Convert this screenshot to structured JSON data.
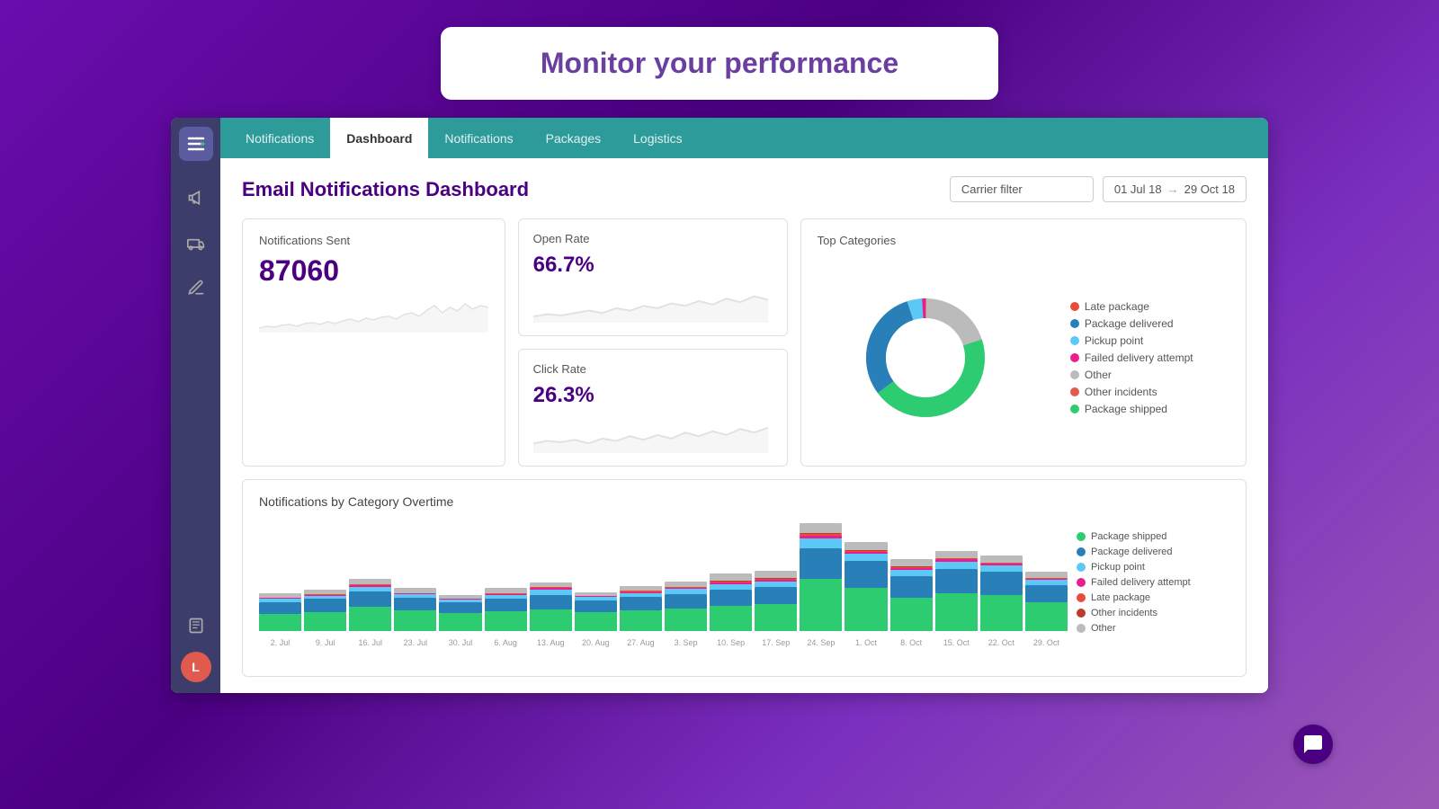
{
  "banner": {
    "title": "Monitor your performance"
  },
  "navbar": {
    "items": [
      {
        "label": "Notifications",
        "active": false
      },
      {
        "label": "Dashboard",
        "active": true
      },
      {
        "label": "Notifications",
        "active": false
      },
      {
        "label": "Packages",
        "active": false
      },
      {
        "label": "Logistics",
        "active": false
      }
    ]
  },
  "page": {
    "title": "Email Notifications Dashboard",
    "carrier_filter_placeholder": "Carrier filter",
    "date_from": "01 Jul 18",
    "date_to": "29 Oct 18"
  },
  "stats": {
    "notifications_sent": {
      "label": "Notifications Sent",
      "value": "87060"
    },
    "open_rate": {
      "label": "Open Rate",
      "value": "66.7%"
    },
    "click_rate": {
      "label": "Click Rate",
      "value": "26.3%"
    }
  },
  "top_categories": {
    "title": "Top Categories",
    "legend": [
      {
        "label": "Late package",
        "color": "#e74c3c"
      },
      {
        "label": "Package delivered",
        "color": "#2980b9"
      },
      {
        "label": "Pickup point",
        "color": "#5bc8f5"
      },
      {
        "label": "Failed delivery attempt",
        "color": "#e91e8c"
      },
      {
        "label": "Other",
        "color": "#bbb"
      },
      {
        "label": "Other incidents",
        "color": "#e05a4e"
      },
      {
        "label": "Package shipped",
        "color": "#2ecc71"
      }
    ]
  },
  "bottom_chart": {
    "title": "Notifications by Category Overtime",
    "legend": [
      {
        "label": "Package shipped",
        "color": "#2ecc71"
      },
      {
        "label": "Package delivered",
        "color": "#2980b9"
      },
      {
        "label": "Pickup point",
        "color": "#5bc8f5"
      },
      {
        "label": "Failed delivery attempt",
        "color": "#e91e8c"
      },
      {
        "label": "Late package",
        "color": "#e74c3c"
      },
      {
        "label": "Other incidents",
        "color": "#c0392b"
      },
      {
        "label": "Other",
        "color": "#bbb"
      }
    ],
    "x_labels": [
      "2. Jul",
      "9. Jul",
      "16. Jul",
      "23. Jul",
      "30. Jul",
      "6. Aug",
      "13. Aug",
      "20. Aug",
      "27. Aug",
      "3. Sep",
      "10. Sep",
      "17. Sep",
      "24. Sep",
      "1. Oct",
      "8. Oct",
      "15. Oct",
      "22. Oct",
      "29. Oct"
    ]
  },
  "sidebar": {
    "icons": [
      {
        "name": "logo-icon",
        "symbol": "↔"
      },
      {
        "name": "megaphone-icon",
        "symbol": "📣"
      },
      {
        "name": "truck-icon",
        "symbol": "🚚"
      },
      {
        "name": "pen-icon",
        "symbol": "✏️"
      },
      {
        "name": "book-icon",
        "symbol": "📋"
      }
    ],
    "avatar_label": "L"
  },
  "chat": {
    "icon": "💬"
  }
}
